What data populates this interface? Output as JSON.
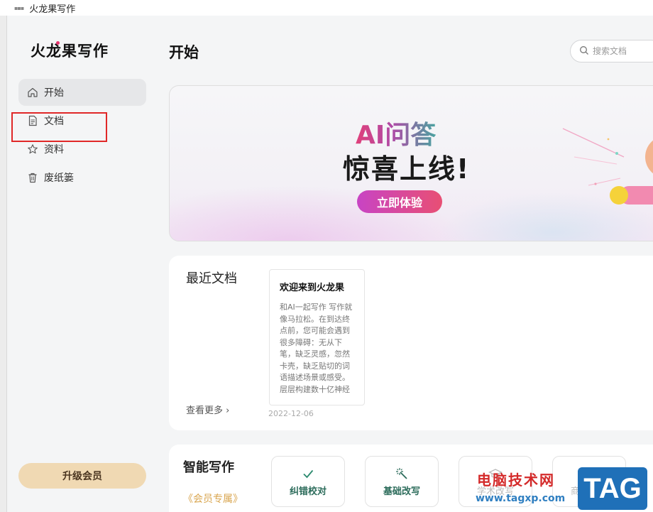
{
  "window": {
    "title": "火龙果写作"
  },
  "sidebar": {
    "logo": "火龙果写作",
    "items": [
      {
        "label": "开始",
        "icon": "home-icon",
        "active": true
      },
      {
        "label": "文档",
        "icon": "document-icon",
        "active": false
      },
      {
        "label": "资料",
        "icon": "star-icon",
        "active": false
      },
      {
        "label": "废纸篓",
        "icon": "trash-icon",
        "active": false
      }
    ],
    "upgrade_label": "升级会员"
  },
  "header": {
    "title": "开始",
    "search_placeholder": "搜索文档"
  },
  "banner": {
    "ai_title": "AI问答",
    "headline": "惊喜上线!",
    "cta_label": "立即体验"
  },
  "recent": {
    "title": "最近文档",
    "view_more": "查看更多",
    "docs": [
      {
        "title": "欢迎来到火龙果",
        "excerpt": "和AI一起写作 写作就像马拉松。在到达终点前，您可能会遇到很多障碍：无从下笔，缺乏灵感，忽然卡壳，缺乏贴切的词语描述场景或感受。 层层构建数十亿神经",
        "date": "2022-12-06"
      }
    ]
  },
  "smart_write": {
    "title": "智能写作",
    "vip_label": "《会员专属》",
    "tools": [
      {
        "label": "纠错校对",
        "icon": "check-icon"
      },
      {
        "label": "基础改写",
        "icon": "magic-wand-icon"
      },
      {
        "label": "学术改写",
        "icon": "graduation-cap-icon"
      },
      {
        "label": "商务改写",
        "icon": "briefcase-icon"
      }
    ]
  },
  "watermark": {
    "title": "电脑技术网",
    "url": "www.tagxp.com",
    "tag": "TAG"
  },
  "colors": {
    "accent_pink": "#e8336c",
    "cta_gradient_start": "#c844c4",
    "cta_gradient_end": "#e84f74",
    "upgrade_bg": "#f0d9b3",
    "tool_label": "#2b6b5a",
    "highlight_box": "#e02828"
  }
}
